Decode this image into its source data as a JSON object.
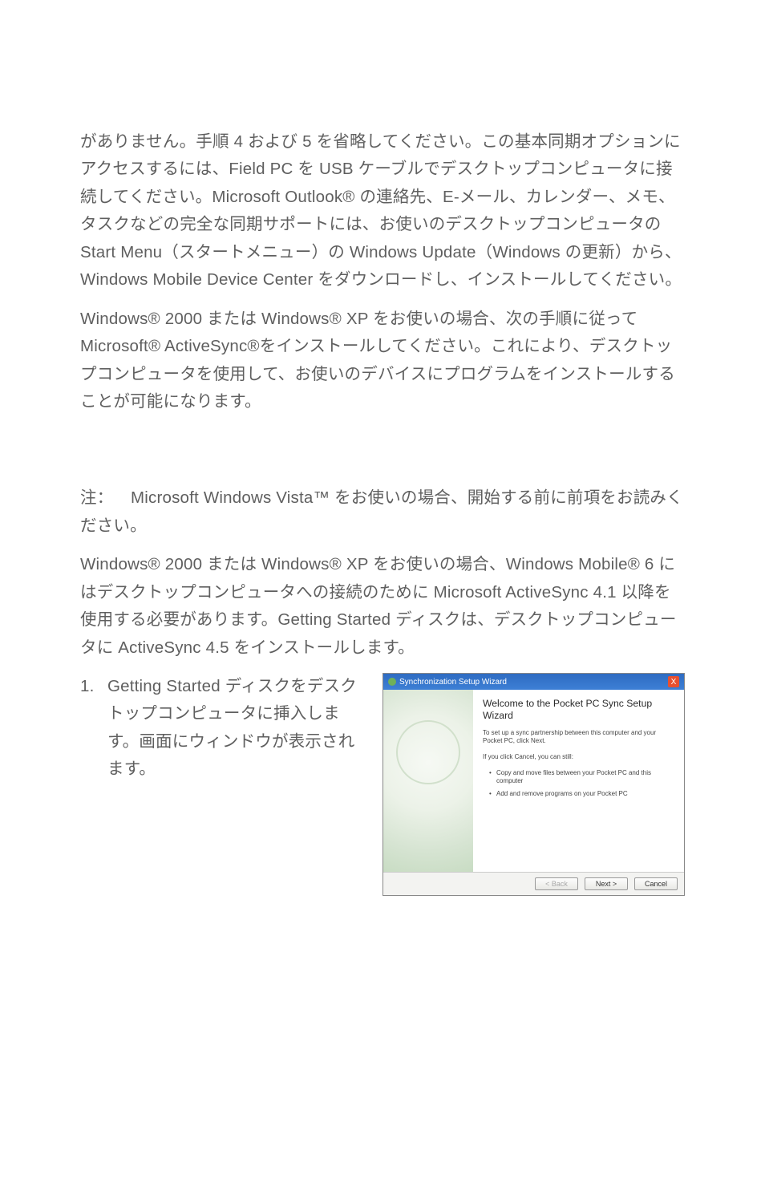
{
  "para1": "がありません。手順 4 および 5 を省略してください。この基本同期オプションにアクセスするには、Field PC を  USB ケーブルでデスクトップコンピュータに接続してください。Microsoft Outlook® の連絡先、E-メール、カレンダー、メモ、タスクなどの完全な同期サポートには、お使いのデスクトップコンピュータの Start Menu（スタートメニュー）の Windows Update（Windows の更新）から、Windows Mobile Device Center をダウンロードし、インストールしてください。",
  "para2": "Windows® 2000 または Windows® XP をお使いの場合、次の手順に従って Microsoft® ActiveSync®をインストールしてください。これにより、デスクトップコンピュータを使用して、お使いのデバイスにプログラムをインストールすることが可能になります。",
  "note_label": "注：",
  "note_body": "Microsoft Windows Vista™ をお使いの場合、開始する前に前項をお読みください。",
  "para3": "Windows® 2000 または Windows® XP をお使いの場合、Windows Mobile® 6 にはデスクトップコンピュータへの接続のために Microsoft ActiveSync 4.1 以降を使用する必要があります。Getting Started ディスクは、デスクトップコンピュータに ActiveSync 4.5 をインストールします。",
  "step1_num": "1.",
  "step1": "Getting Started ディスクをデスクトップコンピュータに挿入します。画面にウィンドウが表示されます。",
  "wizard": {
    "title": "Synchronization Setup Wizard",
    "heading": "Welcome to the Pocket PC Sync Setup Wizard",
    "line1": "To set up a sync partnership between this computer and your Pocket PC, click Next.",
    "line2": "If you click Cancel, you can still:",
    "bullet1": "Copy and move files between your Pocket PC and this computer",
    "bullet2": "Add and remove programs on your Pocket PC",
    "btn_back": "< Back",
    "btn_next": "Next >",
    "btn_cancel": "Cancel",
    "close_x": "X"
  }
}
